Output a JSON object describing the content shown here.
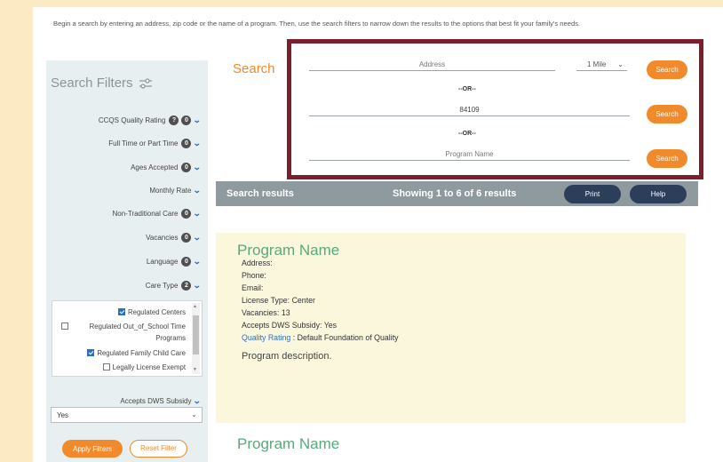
{
  "intro_text": "Begin a search by entering an address, zip code or the name of a program. Then, use the search filters to narrow down the results to the options that best fit your family's needs.",
  "sidebar": {
    "title": "Search Filters",
    "filters": [
      {
        "label": "CCQS Quality Rating",
        "badges": [
          "?",
          "0"
        ]
      },
      {
        "label": "Full Time or Part Time",
        "badges": [
          "0"
        ]
      },
      {
        "label": "Ages Accepted",
        "badges": [
          "0"
        ]
      },
      {
        "label": "Monthly Rate",
        "badges": []
      },
      {
        "label": "Non-Traditional Care",
        "badges": [
          "0"
        ]
      },
      {
        "label": "Vacancies",
        "badges": [
          "0"
        ]
      },
      {
        "label": "Language",
        "badges": [
          "0"
        ]
      },
      {
        "label": "Care Type",
        "badges": [
          "2"
        ]
      }
    ],
    "care_type_options": [
      {
        "label": "Regulated Centers",
        "checked": true
      },
      {
        "label": "Regulated Out_of_School Time Programs",
        "checked": false
      },
      {
        "label": "Regulated Family Child Care",
        "checked": true
      },
      {
        "label": "Legally License Exempt",
        "checked": false
      }
    ],
    "subsidy_label": "Accepts DWS Subsidy",
    "subsidy_value": "Yes",
    "apply_label": "Apply Filters",
    "reset_label": "Reset Filter"
  },
  "search": {
    "heading": "Search",
    "address_placeholder": "Address",
    "distance_value": "1 Mile",
    "zip_value": "84109",
    "or_label": "--OR--",
    "program_placeholder": "Program Name",
    "button_label": "Search"
  },
  "results": {
    "title": "Search results",
    "count_text": "Showing 1 to 6 of 6 results",
    "print_label": "Print",
    "help_label": "Help"
  },
  "programs": [
    {
      "name": "Program Name",
      "address": "Address:",
      "phone": "Phone:",
      "email": "Email:",
      "license": "License Type: Center",
      "vacancies": "Vacancies: 13",
      "subsidy": "Accepts DWS Subsidy: Yes",
      "quality_link": "Quality Rating",
      "quality_value": " : Default Foundation of Quality",
      "description": "Program description."
    },
    {
      "name": "Program Name"
    }
  ],
  "colors": {
    "accent_orange": "#f18a2b",
    "search_border": "#7b1e2e",
    "program_name_green": "#59a97a",
    "link_blue": "#2b6fc1",
    "results_bar": "#8f9a9f",
    "dark_button": "#2c3e5a"
  }
}
